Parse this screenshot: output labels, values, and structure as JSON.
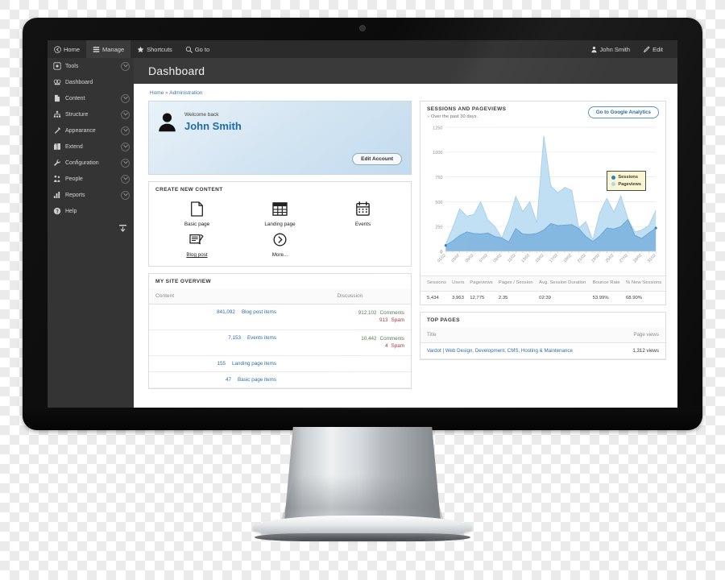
{
  "admin_toolbar": {
    "left_items": [
      {
        "label": "Home",
        "icon": "home-icon",
        "active": false
      },
      {
        "label": "Manage",
        "icon": "hamburger-icon",
        "active": true
      },
      {
        "label": "Shortcuts",
        "icon": "star-icon",
        "active": false
      },
      {
        "label": "Go to",
        "icon": "goto-icon",
        "active": false
      }
    ],
    "right_items": [
      {
        "label": "John Smith",
        "icon": "user-icon"
      },
      {
        "label": "Edit",
        "icon": "pencil-icon"
      }
    ]
  },
  "sidebar": {
    "items": [
      {
        "label": "Tools",
        "icon": "tools-icon",
        "has_chevron": true
      },
      {
        "label": "Dashboard",
        "icon": "dashboard-icon",
        "has_chevron": false
      },
      {
        "label": "Content",
        "icon": "content-icon",
        "has_chevron": true
      },
      {
        "label": "Structure",
        "icon": "structure-icon",
        "has_chevron": true
      },
      {
        "label": "Appearance",
        "icon": "appearance-icon",
        "has_chevron": true
      },
      {
        "label": "Extend",
        "icon": "extend-icon",
        "has_chevron": true
      },
      {
        "label": "Configuration",
        "icon": "configuration-icon",
        "has_chevron": true
      },
      {
        "label": "People",
        "icon": "people-icon",
        "has_chevron": true
      },
      {
        "label": "Reports",
        "icon": "reports-icon",
        "has_chevron": true
      },
      {
        "label": "Help",
        "icon": "help-icon",
        "has_chevron": false
      }
    ],
    "collapse_icon": "collapse-tray-icon"
  },
  "page": {
    "title": "Dashboard",
    "breadcrumb": [
      "Home",
      "Administration"
    ],
    "breadcrumb_separator": "»"
  },
  "welcome": {
    "greeting": "Welcome back",
    "name": "John Smith",
    "edit_button": "Edit Account",
    "avatar_icon": "user-avatar-icon"
  },
  "create_content": {
    "title": "CREATE NEW CONTENT",
    "items": [
      {
        "label": "Basic page",
        "icon": "page-icon",
        "underline": false
      },
      {
        "label": "Landing page",
        "icon": "grid-icon",
        "underline": false
      },
      {
        "label": "Events",
        "icon": "calendar-icon",
        "underline": false
      },
      {
        "label": "Blog post",
        "icon": "blog-icon",
        "underline": true
      },
      {
        "label": "More...",
        "icon": "arrow-circle-icon",
        "underline": false
      }
    ]
  },
  "site_overview": {
    "title": "MY SITE OVERVIEW",
    "columns": [
      "Content",
      "Discussion"
    ],
    "rows": [
      {
        "count": "841,092",
        "label": "Blog post items",
        "discussion": [
          {
            "value": "912,102",
            "label": "Comments",
            "kind": "comments"
          },
          {
            "value": "913",
            "label": "Spam",
            "kind": "spam"
          }
        ]
      },
      {
        "count": "7,153",
        "label": "Events items",
        "discussion": [
          {
            "value": "10,442",
            "label": "Comments",
            "kind": "comments"
          },
          {
            "value": "4",
            "label": "Spam",
            "kind": "spam"
          }
        ]
      },
      {
        "count": "155",
        "label": "Landing page items",
        "discussion": []
      },
      {
        "count": "47",
        "label": "Basic page items",
        "discussion": []
      }
    ]
  },
  "analytics": {
    "title": "SESSIONS AND PAGEVIEWS",
    "subtitle": "Over the past 30 days.",
    "subtitle_bullet": "»",
    "button": "Go to Google Analytics",
    "stats_columns": [
      "Sessions",
      "Users",
      "Pageviews",
      "Pages / Session",
      "Avg. Session Duration",
      "Bounce Rate",
      "% New Sessions"
    ],
    "stats_values": [
      "5,434",
      "3,963",
      "12,775",
      "2.35",
      "02:39",
      "53.99%",
      "68.90%"
    ]
  },
  "top_pages": {
    "title": "TOP PAGES",
    "columns": [
      "Title",
      "Page views"
    ],
    "rows": [
      {
        "title": "Vardot | Web Design, Development, CMS, Hosting & Maintenance",
        "views": "1,312 views"
      }
    ]
  },
  "colors": {
    "sessions": "#2a7fc9",
    "sessions_fill": "#7fb4e0",
    "pageviews": "#aed4ef",
    "pageviews_fill": "#b9dbf2",
    "link": "#2b6cb0",
    "toolbar": "#2b2b2b",
    "sidebar": "#343434",
    "page_header": "#3a3a3a",
    "legend_bg": "#fbf6d2"
  },
  "chart_data": {
    "type": "area",
    "title": "Sessions and Pageviews",
    "xlabel": "",
    "ylabel": "",
    "ylim": [
      0,
      1250
    ],
    "yticks": [
      0,
      250,
      500,
      750,
      1000,
      1250
    ],
    "grid": true,
    "legend_position": "inside-right",
    "x": [
      "01/02",
      "02/02",
      "03/02",
      "04/02",
      "05/02",
      "06/02",
      "07/02",
      "08/02",
      "09/02",
      "10/02",
      "11/02",
      "12/02",
      "13/02",
      "14/02",
      "15/02",
      "16/02",
      "17/02",
      "18/02",
      "19/02",
      "20/02",
      "21/02",
      "22/02",
      "23/02",
      "24/02",
      "25/02",
      "26/02",
      "27/02",
      "28/02",
      "29/02",
      "30/02",
      "31/02"
    ],
    "xtick_labels": [
      "01/02",
      "03/02",
      "05/02",
      "07/02",
      "09/02",
      "11/02",
      "13/02",
      "15/02",
      "17/02",
      "19/02",
      "21/02",
      "23/02",
      "25/02",
      "27/02",
      "29/02",
      "31/02"
    ],
    "series": [
      {
        "name": "Pageviews",
        "color": "#b9dbf2",
        "values": [
          75,
          240,
          430,
          355,
          370,
          500,
          320,
          255,
          135,
          310,
          555,
          400,
          500,
          290,
          1165,
          660,
          590,
          645,
          615,
          235,
          300,
          115,
          390,
          535,
          395,
          560,
          330,
          195,
          215,
          260,
          415
        ]
      },
      {
        "name": "Sessions",
        "color": "#7fb4e0",
        "values": [
          60,
          105,
          160,
          195,
          180,
          175,
          185,
          150,
          135,
          95,
          230,
          175,
          170,
          180,
          215,
          280,
          260,
          265,
          270,
          230,
          150,
          100,
          155,
          235,
          225,
          250,
          320,
          160,
          130,
          185,
          235
        ]
      }
    ]
  }
}
